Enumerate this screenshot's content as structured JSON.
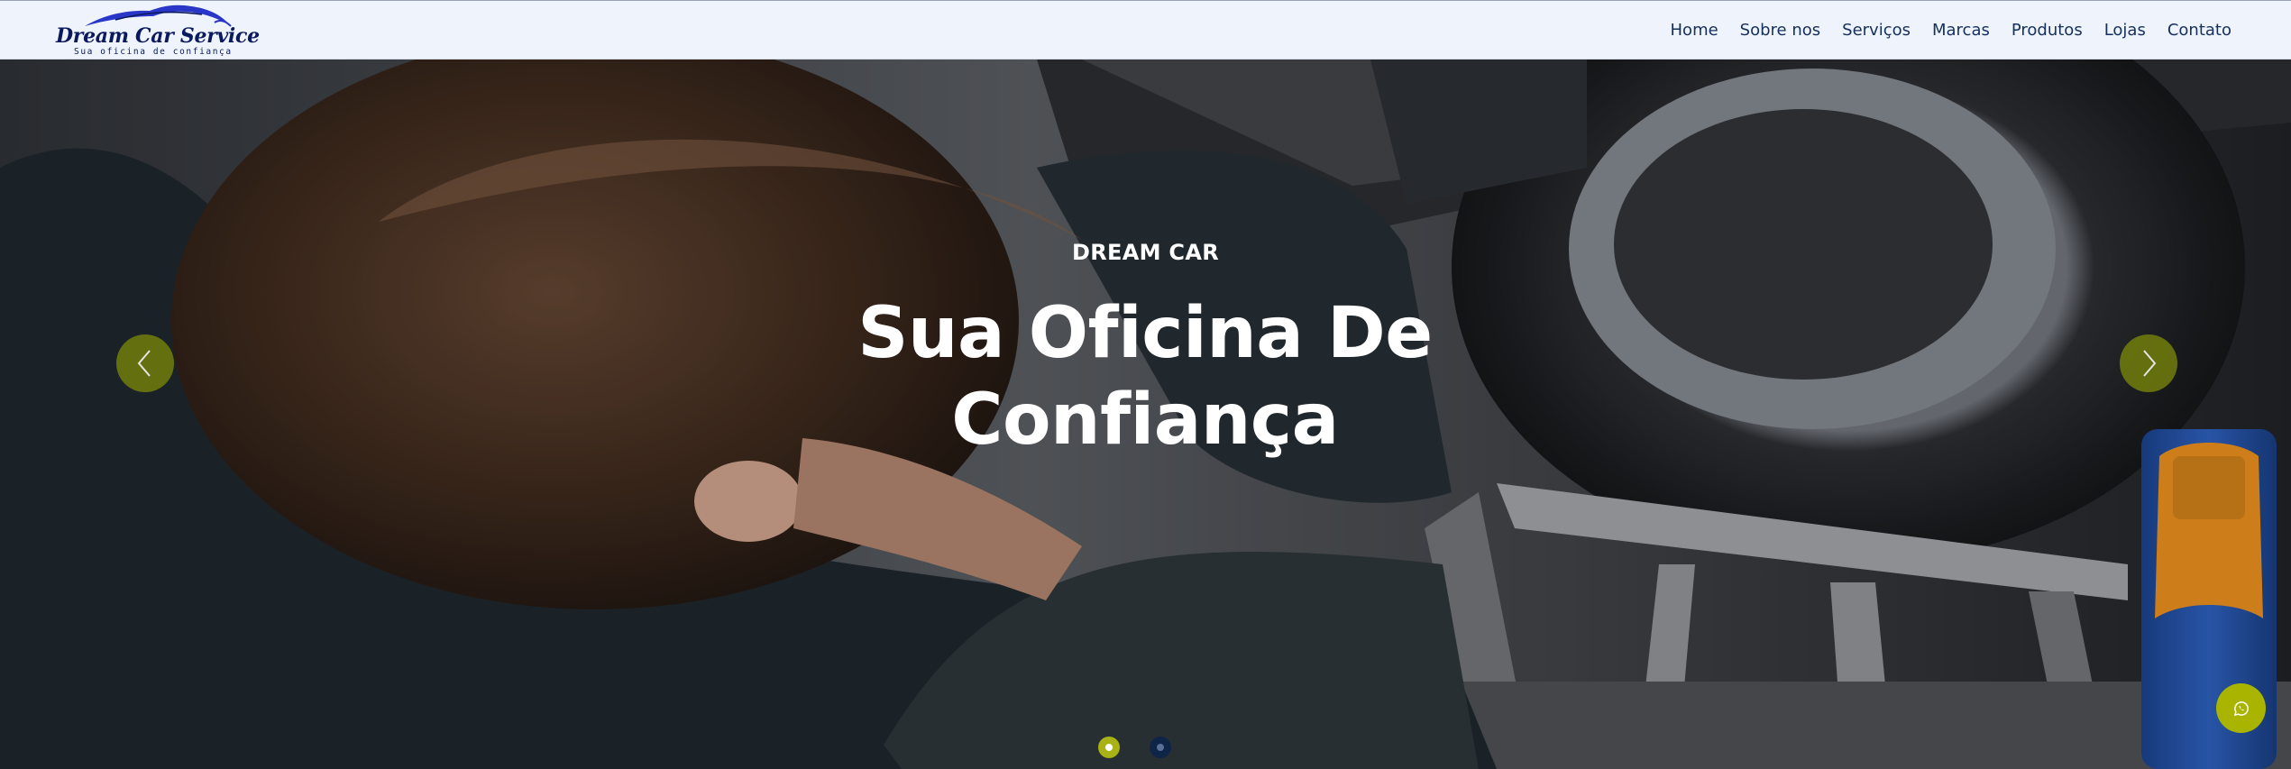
{
  "brand": {
    "title": "Dream Car Service",
    "tagline": "Sua oficina de confiança",
    "logo_icon": "car-silhouette-icon",
    "colors": {
      "navy": "#0b1a5c",
      "swoosh": "#2a36c8"
    }
  },
  "nav": {
    "items": [
      {
        "label": "Home"
      },
      {
        "label": "Sobre nos"
      },
      {
        "label": "Serviços"
      },
      {
        "label": "Marcas"
      },
      {
        "label": "Produtos"
      },
      {
        "label": "Lojas"
      },
      {
        "label": "Contato"
      }
    ]
  },
  "hero": {
    "eyebrow": "DREAM CAR",
    "headline": "Sua Oficina De Confiança",
    "prev_icon": "chevron-left-icon",
    "next_icon": "chevron-right-icon",
    "slide_count": 2,
    "active_slide": 1,
    "accent_color": "#a9b214"
  },
  "floating": {
    "whatsapp_icon": "whatsapp-icon",
    "color": "#a9b400"
  }
}
